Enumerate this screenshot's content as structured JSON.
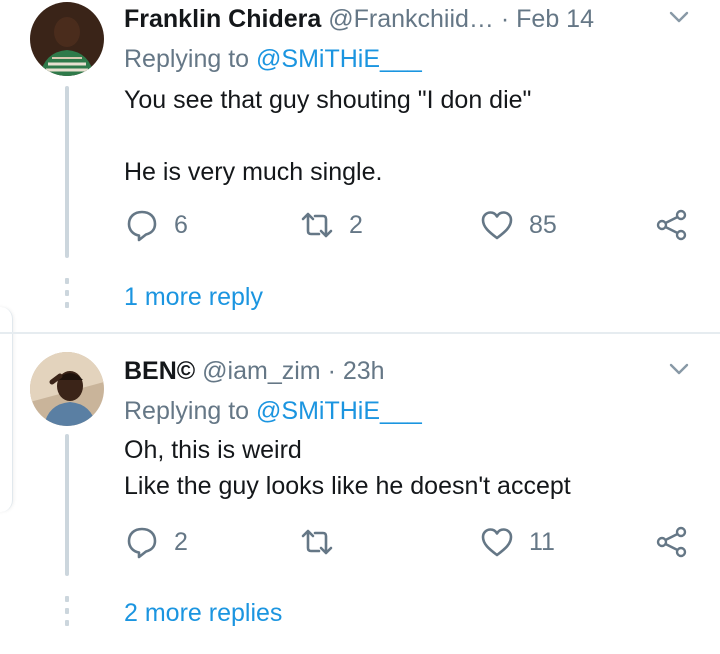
{
  "tweets": [
    {
      "author_name": "Franklin Chidera",
      "handle": "@Frankchiid…",
      "separator": "·",
      "time": "Feb 14",
      "replying_prefix": "Replying to",
      "replying_to": "@SMiTHiE___",
      "body_lines": [
        "You see that guy shouting \"I don die\"",
        "",
        "He is very much single."
      ],
      "reply_count": "6",
      "retweet_count": "2",
      "like_count": "85",
      "more_replies": "1 more reply"
    },
    {
      "author_name": "BEN©",
      "handle": "@iam_zim",
      "separator": "·",
      "time": "23h",
      "replying_prefix": "Replying to",
      "replying_to": "@SMiTHiE___",
      "body_lines": [
        "Oh, this is weird",
        "Like the guy looks like he doesn't accept"
      ],
      "reply_count": "2",
      "retweet_count": "",
      "like_count": "11",
      "more_replies": "2 more replies"
    }
  ],
  "icons": {
    "reply": "reply-icon",
    "retweet": "retweet-icon",
    "like": "heart-icon",
    "share": "share-icon",
    "menu": "chevron-down-icon"
  },
  "colors": {
    "link": "#1b95e0",
    "secondary_text": "#657786",
    "primary_text": "#14171a",
    "thread_line": "#ccd6dd",
    "divider": "#e6ecf0"
  }
}
